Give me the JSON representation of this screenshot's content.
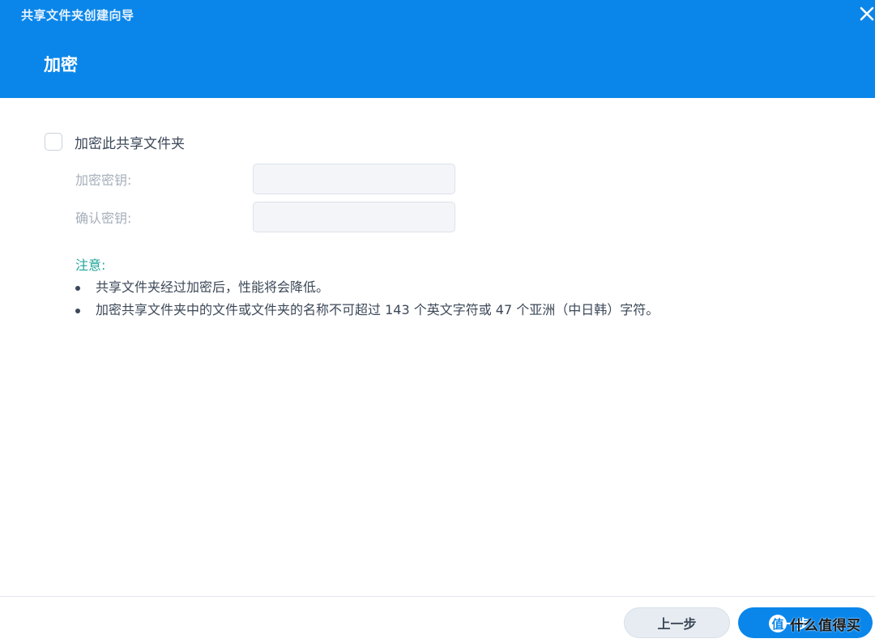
{
  "window": {
    "title": "共享文件夹创建向导",
    "close_glyph": "✕"
  },
  "header": {
    "step_title": "加密"
  },
  "form": {
    "encrypt_checkbox_label": "加密此共享文件夹",
    "encrypt_checked": false,
    "fields": [
      {
        "label": "加密密钥:",
        "value": ""
      },
      {
        "label": "确认密钥:",
        "value": ""
      }
    ]
  },
  "notes": {
    "title": "注意:",
    "items": [
      "共享文件夹经过加密后，性能将会降低。",
      "加密共享文件夹中的文件或文件夹的名称不可超过 143 个英文字符或 47 个亚洲（中日韩）字符。"
    ]
  },
  "footer": {
    "prev_label": "上一步",
    "next_label": "下一步"
  },
  "watermark": {
    "logo_char": "值",
    "text": "什么值得买"
  },
  "colors": {
    "header_bg": "#0a86ea",
    "note_title": "#21a69b",
    "primary_button": "#0a86ea"
  }
}
